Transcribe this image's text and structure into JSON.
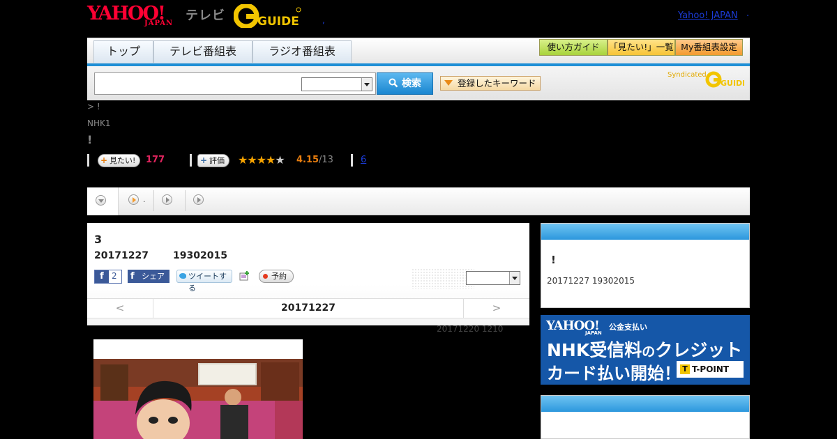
{
  "header": {
    "logo_yahoo": "YAHOO!",
    "logo_yahoo_sub": "JAPAN",
    "logo_tv": "テレビ",
    "logo_gguide": "G-GUIDE",
    "yahoo_japan_link": "Yahoo! JAPAN",
    "dot_right": ".",
    "dot_mid": ","
  },
  "nav": {
    "tabs": [
      {
        "label": "トップ"
      },
      {
        "label": "テレビ番組表"
      },
      {
        "label": "ラジオ番組表"
      }
    ],
    "buttons": {
      "guide": "使い方ガイド",
      "mitai_list": "「見たい!」一覧",
      "my_settings": "My番組表設定"
    }
  },
  "search": {
    "placeholder": "",
    "value": "",
    "select_value": "",
    "button_label": "検索",
    "keyword_button": "登録したキーワード",
    "syndicated": "Syndicated"
  },
  "program": {
    "breadcrumb": "> !",
    "station": "NHK1",
    "title": "!",
    "mitai_label": "見たい!",
    "mitai_count": "177",
    "rate_label": "評価",
    "stars": "★★★★",
    "star_empty": "★",
    "rating": "4.15",
    "rating_count": "/13",
    "review_link": "6"
  },
  "subtabs": {
    "tab2_label": "."
  },
  "episode": {
    "title": "3",
    "date": "20171227",
    "time": "19302015",
    "fb_like_count": "2",
    "fb_share_label": "シェア",
    "tweet_label": "ツイートする",
    "reserve_label": "予約",
    "select_value": "",
    "nav_prev": "<",
    "nav_date": "20171227",
    "nav_next": ">",
    "update_text": "20171220  1210"
  },
  "sidebar": {
    "box_title": "!",
    "box_time": "20171227  19302015",
    "ad": {
      "yahoo": "YAHOO!",
      "yahoo_sub": "JAPAN",
      "kokin": "公金支払い",
      "line1a": "NHK受信料",
      "line1b": "の",
      "line1c": "クレジット",
      "line2": "カード払い開始！",
      "tpoint": "T-POINT",
      "tpoint_t": "T"
    }
  },
  "colors": {
    "yahoo_red": "#ff0033",
    "accent_blue": "#1f8fd6",
    "mitai_pink": "#e0245e",
    "star_orange": "#f7a300",
    "ad_blue": "#1557a8"
  }
}
